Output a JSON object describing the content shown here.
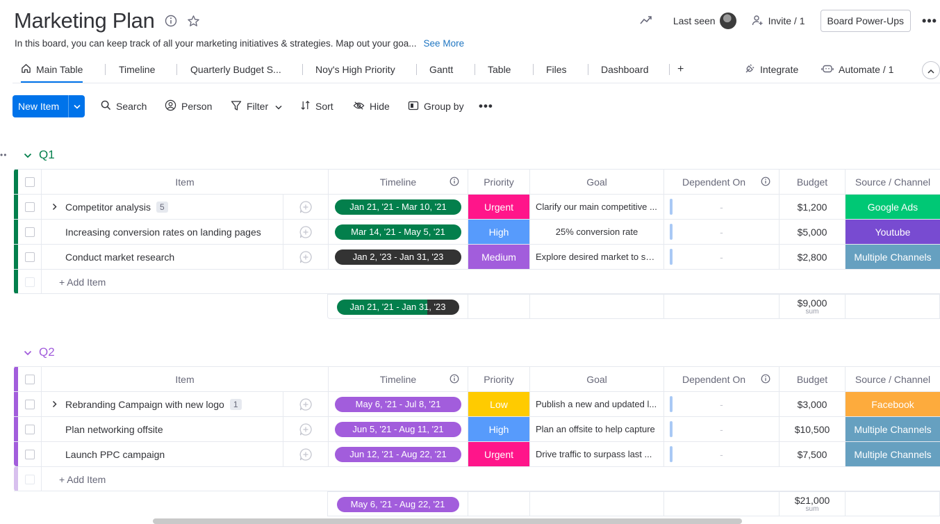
{
  "board": {
    "title": "Marketing Plan",
    "description": "In this board, you can keep track of all your marketing initiatives & strategies. Map out your goa...",
    "see_more": "See More"
  },
  "header_actions": {
    "last_seen": "Last seen",
    "invite": "Invite / 1",
    "power_ups": "Board Power-Ups"
  },
  "tabs": [
    {
      "label": "Main Table",
      "icon": "home-icon"
    },
    {
      "label": "Timeline"
    },
    {
      "label": "Quarterly Budget S..."
    },
    {
      "label": "Noy's High Priority"
    },
    {
      "label": "Gantt"
    },
    {
      "label": "Table"
    },
    {
      "label": "Files"
    },
    {
      "label": "Dashboard"
    },
    {
      "label": "+"
    }
  ],
  "tab_actions": {
    "integrate": "Integrate",
    "automate": "Automate / 1"
  },
  "toolbar": {
    "new_item": "New Item",
    "search": "Search",
    "person": "Person",
    "filter": "Filter",
    "sort": "Sort",
    "hide": "Hide",
    "group_by": "Group by"
  },
  "columns": {
    "item": "Item",
    "timeline": "Timeline",
    "priority": "Priority",
    "goal": "Goal",
    "dependent_on": "Dependent On",
    "budget": "Budget",
    "source": "Source / Channel"
  },
  "add_item_label": "+ Add Item",
  "sum_label": "sum",
  "dash": "-",
  "colors": {
    "q1": "#037f4c",
    "q2": "#a25ddc",
    "urgent": "#ff158a",
    "high": "#579bfc",
    "medium": "#a25ddc",
    "low": "#ffcb00",
    "google_ads": "#00c875",
    "youtube": "#784bd1",
    "multiple": "#66a0c0",
    "facebook": "#fdab3d",
    "accent": "#0073ea"
  },
  "groups": [
    {
      "name": "Q1",
      "color": "#037f4c",
      "rows": [
        {
          "item": "Competitor analysis",
          "subitems": "5",
          "timeline": "Jan 21, '21 - Mar 10, '21",
          "timeline_color": "#037f4c",
          "priority": "Urgent",
          "priority_color": "#ff158a",
          "goal": "Clarify our main competitive ...",
          "goal_align": "left",
          "budget": "$1,200",
          "source": "Google Ads",
          "source_color": "#00c875"
        },
        {
          "item": "Increasing conversion rates on landing pages",
          "subitems": "",
          "timeline": "Mar 14, '21 - May 5, '21",
          "timeline_color": "#037f4c",
          "priority": "High",
          "priority_color": "#579bfc",
          "goal": "25% conversion rate",
          "goal_align": "center",
          "budget": "$5,000",
          "source": "Youtube",
          "source_color": "#784bd1"
        },
        {
          "item": "Conduct market research",
          "subitems": "",
          "timeline": "Jan 2, '23 - Jan 31, '23",
          "timeline_color": "#333333",
          "priority": "Medium",
          "priority_color": "#a25ddc",
          "goal": "Explore desired market to se...",
          "goal_align": "left",
          "budget": "$2,800",
          "source": "Multiple Channels",
          "source_color": "#66a0c0"
        }
      ],
      "summary": {
        "timeline": "Jan 21, '21 - Jan 31, '23",
        "budget": "$9,000"
      }
    },
    {
      "name": "Q2",
      "color": "#a25ddc",
      "rows": [
        {
          "item": "Rebranding Campaign with new logo",
          "subitems": "1",
          "timeline": "May 6, '21 - Jul 8, '21",
          "timeline_color": "#a25ddc",
          "priority": "Low",
          "priority_color": "#ffcb00",
          "goal": "Publish a new and updated l...",
          "goal_align": "left",
          "budget": "$3,000",
          "source": "Facebook",
          "source_color": "#fdab3d"
        },
        {
          "item": "Plan networking offsite",
          "subitems": "",
          "timeline": "Jun 5, '21 - Aug 11, '21",
          "timeline_color": "#a25ddc",
          "priority": "High",
          "priority_color": "#579bfc",
          "goal": "Plan an offsite to help capture",
          "goal_align": "left",
          "budget": "$10,500",
          "source": "Multiple Channels",
          "source_color": "#66a0c0"
        },
        {
          "item": "Launch PPC campaign",
          "subitems": "",
          "timeline": "Jun 12, '21 - Aug 22, '21",
          "timeline_color": "#a25ddc",
          "priority": "Urgent",
          "priority_color": "#ff158a",
          "goal": "Drive traffic to surpass last ...",
          "goal_align": "left",
          "budget": "$7,500",
          "source": "Multiple Channels",
          "source_color": "#66a0c0"
        }
      ],
      "summary": {
        "timeline": "May 6, '21 - Aug 22, '21",
        "budget": "$21,000"
      }
    }
  ]
}
